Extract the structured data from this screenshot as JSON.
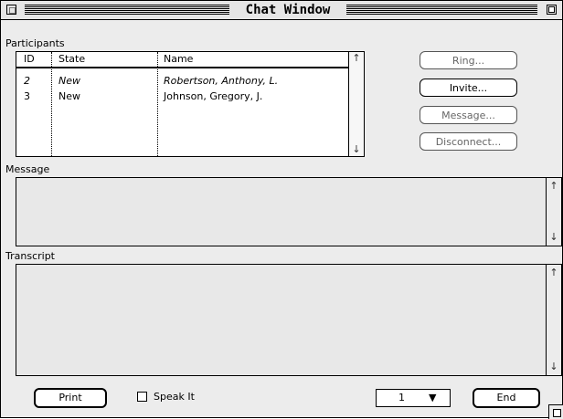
{
  "window": {
    "title": "Chat Window"
  },
  "participants": {
    "label": "Participants",
    "columns": [
      "ID",
      "State",
      "Name"
    ],
    "rows": [
      {
        "id": "2",
        "state": "New",
        "name": "Robertson, Anthony, L.",
        "italic": true
      },
      {
        "id": "3",
        "state": "New",
        "name": "Johnson, Gregory, J.",
        "italic": false
      }
    ]
  },
  "buttons": {
    "ring": "Ring...",
    "invite": "Invite...",
    "message": "Message...",
    "disconnect": "Disconnect...",
    "print": "Print",
    "end": "End"
  },
  "message": {
    "label": "Message",
    "value": ""
  },
  "transcript": {
    "label": "Transcript",
    "value": ""
  },
  "speak_it": {
    "label": "Speak It",
    "checked": false
  },
  "page_select": {
    "value": "1"
  },
  "icons": {
    "scroll_up": "↑",
    "scroll_down": "↓",
    "dropdown": "▼"
  }
}
